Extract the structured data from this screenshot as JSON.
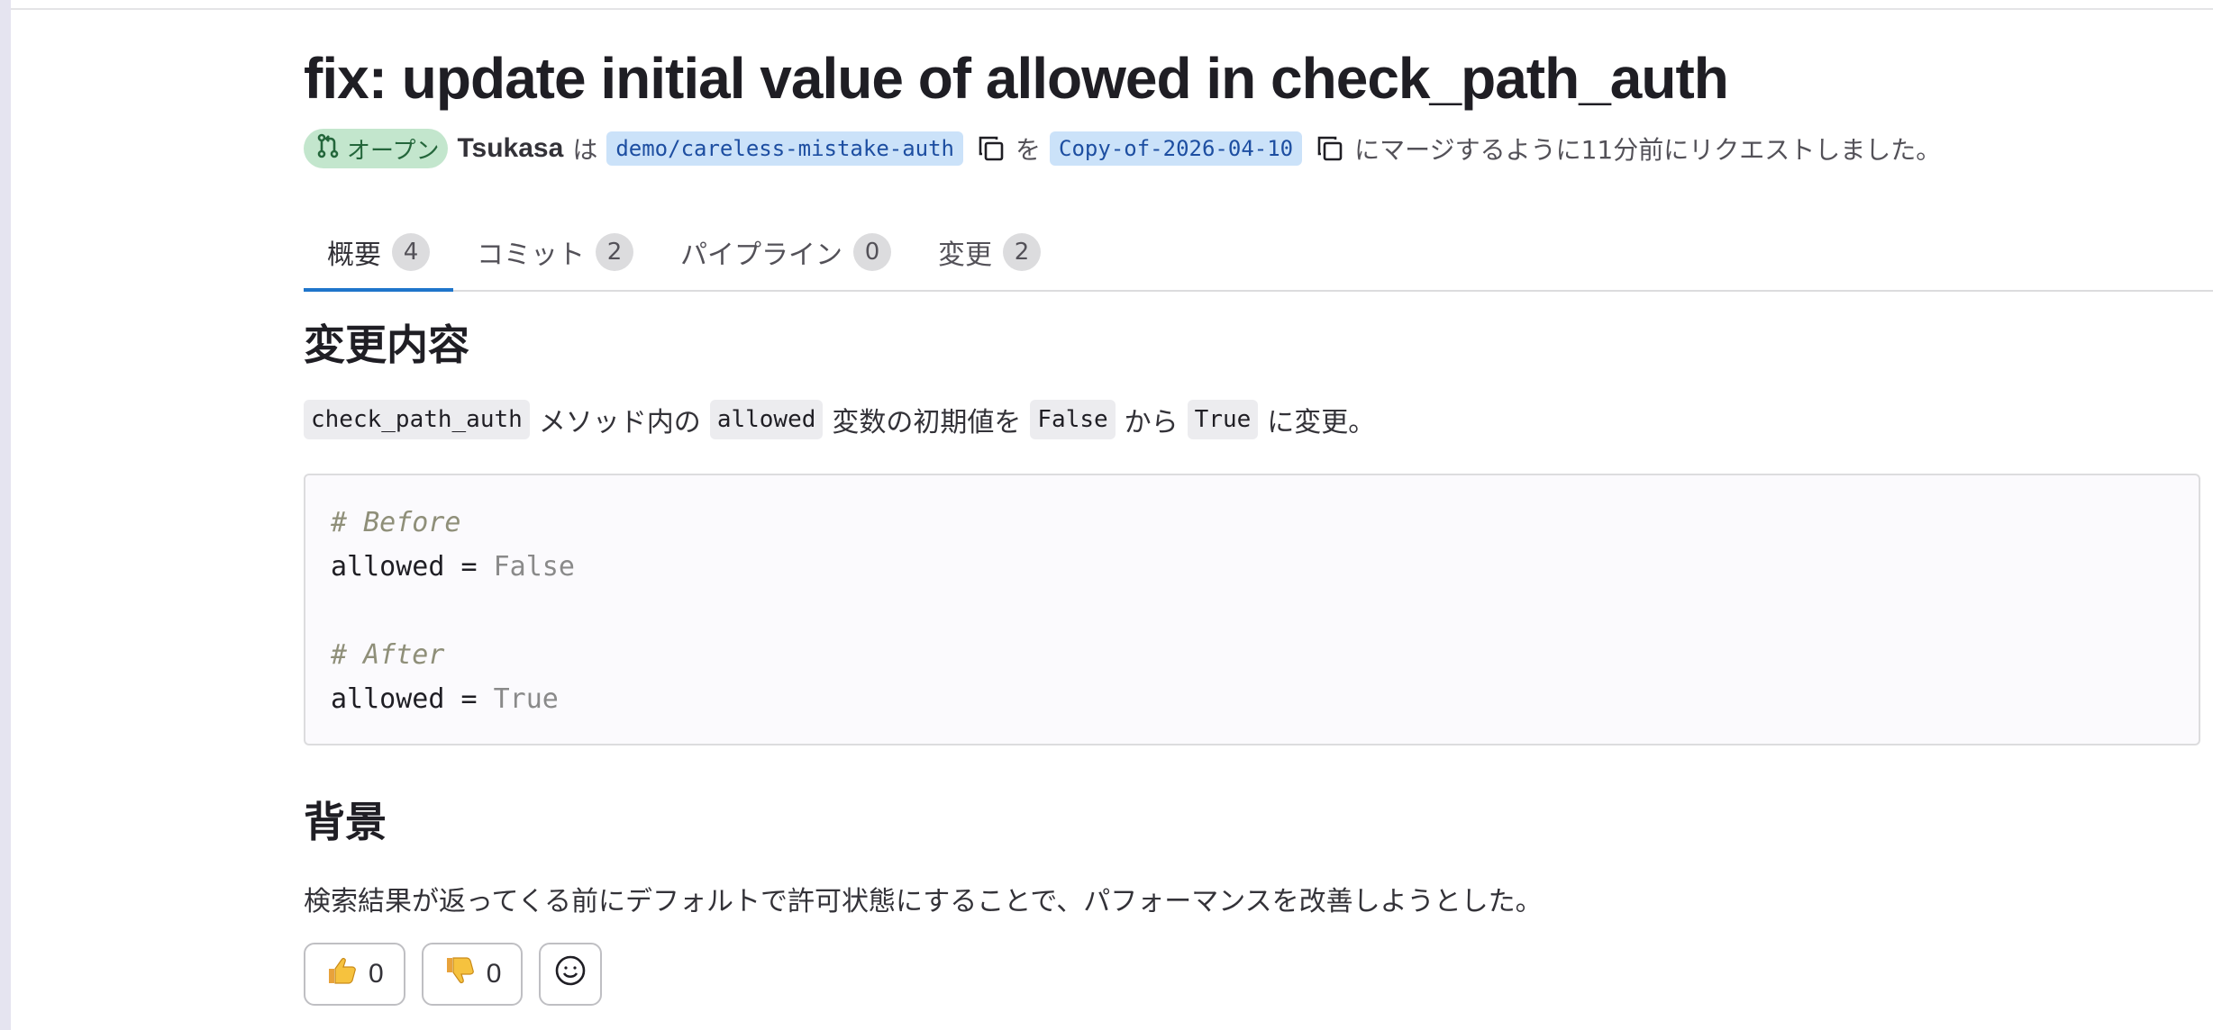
{
  "mr": {
    "title": "fix: update initial value of allowed in check_path_auth",
    "status": "オープン",
    "author": "Tsukasa",
    "particle_ha": "は",
    "source_branch": "demo/careless-mistake-auth",
    "particle_wo": "を",
    "target_branch": "Copy-of-2026-04-10",
    "request_text": "にマージするように11分前にリクエストしました。"
  },
  "tabs": [
    {
      "label": "概要",
      "count": "4"
    },
    {
      "label": "コミット",
      "count": "2"
    },
    {
      "label": "パイプライン",
      "count": "0"
    },
    {
      "label": "変更",
      "count": "2"
    }
  ],
  "description": {
    "heading_changes": "変更内容",
    "summary": {
      "code1": "check_path_auth",
      "text1": "メソッド内の",
      "code2": "allowed",
      "text2": "変数の初期値を",
      "code3": "False",
      "text3": "から",
      "code4": "True",
      "text4": "に変更。"
    },
    "code": {
      "comment_before": "# Before",
      "line_before_lhs": "allowed = ",
      "line_before_value": "False",
      "comment_after": "# After",
      "line_after_lhs": "allowed = ",
      "line_after_value": "True"
    },
    "heading_background": "背景",
    "background_text": "検索結果が返ってくる前にデフォルトで許可状態にすることで、パフォーマンスを改善しようとした。"
  },
  "reactions": {
    "thumbs_up_count": "0",
    "thumbs_down_count": "0"
  },
  "icons": {
    "status": "merge-request-icon",
    "copy": "copy-icon",
    "thumbs_up": "thumbs-up-icon",
    "thumbs_down": "thumbs-down-icon",
    "emoji": "smiley-icon"
  },
  "colors": {
    "status_bg": "#c3e6cd",
    "status_text": "#24663b",
    "branch_bg": "#cbe2f9",
    "branch_text": "#1d4ea1",
    "tab_active": "#1f75cb"
  }
}
